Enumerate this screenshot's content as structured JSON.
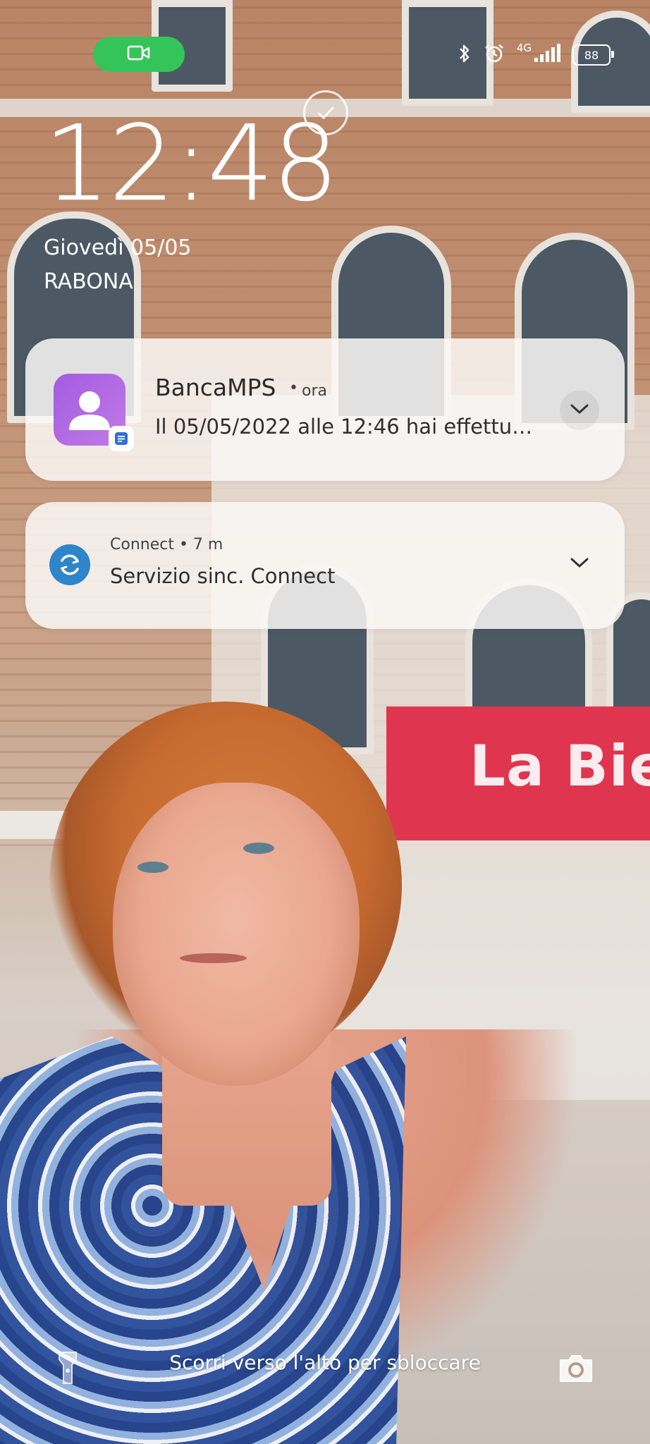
{
  "status_bar": {
    "network_type": "4G",
    "battery_level": "88",
    "icons": [
      "video-call-icon",
      "bluetooth-icon",
      "alarm-icon",
      "signal-icon",
      "battery-icon"
    ],
    "call_pill_color": "#35c45a"
  },
  "lock_screen": {
    "time": "12:48",
    "date": "Giovedì 05/05",
    "location": "RABONA"
  },
  "notifications": [
    {
      "app": "BancaMPS",
      "time_sep": "•",
      "time": "ora",
      "text": "Il 05/05/2022 alle 12:46 hai effettu…",
      "icon": "contact-icon",
      "badge_icon": "message-icon",
      "accent": "#a35ce0"
    },
    {
      "app_line": "Connect • 7 m",
      "text": "Servizio sinc. Connect",
      "icon": "sync-icon",
      "accent": "#2f85c9"
    }
  ],
  "bottom": {
    "hint": "Scorri verso l'alto per sbloccare",
    "left_icon": "flashlight-icon",
    "right_icon": "camera-icon"
  },
  "wallpaper": {
    "banner_text": "La Bien"
  }
}
